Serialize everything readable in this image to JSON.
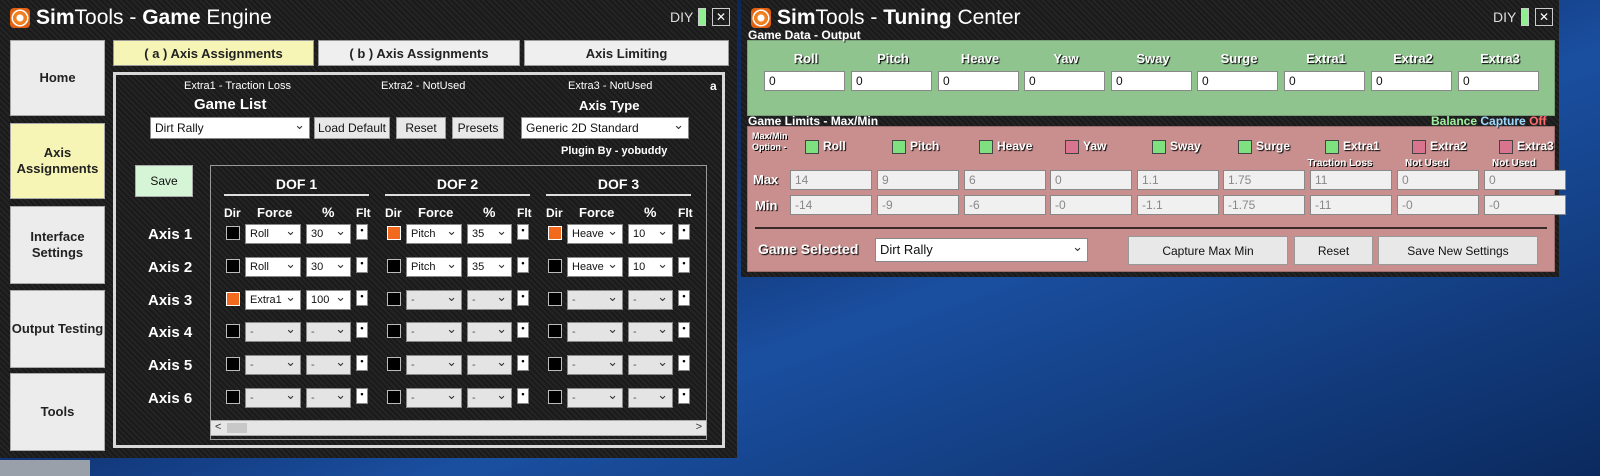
{
  "game_engine": {
    "title_light": "Sim",
    "title_rest": "Tools - ",
    "title_bold": "Game",
    "title_end": " Engine",
    "diy": "DIY",
    "close": "✕",
    "nav": [
      {
        "label": "Home"
      },
      {
        "label": "Axis Assignments"
      },
      {
        "label": "Interface Settings"
      },
      {
        "label": "Output Testing"
      },
      {
        "label": "Tools"
      }
    ],
    "tabs": [
      {
        "label": "( a ) Axis Assignments"
      },
      {
        "label": "( b ) Axis Assignments"
      },
      {
        "label": "Axis Limiting"
      }
    ],
    "extra1": "Extra1 - Traction Loss",
    "extra2": "Extra2 - NotUsed",
    "extra3": "Extra3 - NotUsed",
    "corner": "a",
    "game_list_label": "Game List",
    "axis_type_label": "Axis Type",
    "game_value": "Dirt Rally",
    "load_default": "Load Default",
    "reset": "Reset",
    "presets": "Presets",
    "axis_type_value": "Generic 2D Standard",
    "plugin": "Plugin By - yobuddy",
    "save": "Save",
    "dof": [
      "DOF 1",
      "DOF 2",
      "DOF 3"
    ],
    "col_headers": {
      "dir": "Dir",
      "force": "Force",
      "pct": "%",
      "flt": "Flt"
    },
    "flt_mark": "•",
    "axes": [
      {
        "label": "Axis 1",
        "cells": [
          {
            "dir": false,
            "force": "Roll",
            "pct": "30"
          },
          {
            "dir": true,
            "force": "Pitch",
            "pct": "35"
          },
          {
            "dir": true,
            "force": "Heave",
            "pct": "10"
          }
        ]
      },
      {
        "label": "Axis 2",
        "cells": [
          {
            "dir": false,
            "force": "Roll",
            "pct": "30"
          },
          {
            "dir": false,
            "force": "Pitch",
            "pct": "35"
          },
          {
            "dir": false,
            "force": "Heave",
            "pct": "10"
          }
        ]
      },
      {
        "label": "Axis 3",
        "cells": [
          {
            "dir": true,
            "force": "Extra1",
            "pct": "100"
          },
          {
            "dir": false,
            "force": "-",
            "pct": "-"
          },
          {
            "dir": false,
            "force": "-",
            "pct": "-"
          }
        ]
      },
      {
        "label": "Axis 4",
        "cells": [
          {
            "dir": false,
            "force": "-",
            "pct": "-"
          },
          {
            "dir": false,
            "force": "-",
            "pct": "-"
          },
          {
            "dir": false,
            "force": "-",
            "pct": "-"
          }
        ]
      },
      {
        "label": "Axis 5",
        "cells": [
          {
            "dir": false,
            "force": "-",
            "pct": "-"
          },
          {
            "dir": false,
            "force": "-",
            "pct": "-"
          },
          {
            "dir": false,
            "force": "-",
            "pct": "-"
          }
        ]
      },
      {
        "label": "Axis 6",
        "cells": [
          {
            "dir": false,
            "force": "-",
            "pct": "-"
          },
          {
            "dir": false,
            "force": "-",
            "pct": "-"
          },
          {
            "dir": false,
            "force": "-",
            "pct": "-"
          }
        ]
      }
    ],
    "scroll_left": "<",
    "scroll_right": ">"
  },
  "tuning": {
    "title_light": "Sim",
    "title_rest": "Tools - ",
    "title_bold": "Tuning",
    "title_end": " Center",
    "diy": "DIY",
    "close": "✕",
    "game_data_label": "Game Data - Output",
    "game_limits_label": "Game Limits - Max/Min",
    "balance": "Balance",
    "capture": "Capture",
    "off": "Off",
    "option_label": "Max/Min Option -",
    "max_label": "Max",
    "min_label": "Min",
    "channels": [
      {
        "name": "Roll",
        "output": "0",
        "max": "14",
        "min": "-14",
        "sub": "",
        "color": "#7ee07e"
      },
      {
        "name": "Pitch",
        "output": "0",
        "max": "9",
        "min": "-9",
        "sub": "",
        "color": "#7ee07e"
      },
      {
        "name": "Heave",
        "output": "0",
        "max": "6",
        "min": "-6",
        "sub": "",
        "color": "#7ee07e"
      },
      {
        "name": "Yaw",
        "output": "0",
        "max": "0",
        "min": "-0",
        "sub": "",
        "color": "#d9748f"
      },
      {
        "name": "Sway",
        "output": "0",
        "max": "1.1",
        "min": "-1.1",
        "sub": "",
        "color": "#7ee07e"
      },
      {
        "name": "Surge",
        "output": "0",
        "max": "1.75",
        "min": "-1.75",
        "sub": "",
        "color": "#7ee07e"
      },
      {
        "name": "Extra1",
        "output": "0",
        "max": "11",
        "min": "-11",
        "sub": "Traction Loss",
        "color": "#7ee07e"
      },
      {
        "name": "Extra2",
        "output": "0",
        "max": "0",
        "min": "-0",
        "sub": "Not Used",
        "color": "#d9748f"
      },
      {
        "name": "Extra3",
        "output": "0",
        "max": "0",
        "min": "-0",
        "sub": "Not Used",
        "color": "#d9748f"
      }
    ],
    "game_selected_label": "Game Selected",
    "game_selected_value": "Dirt Rally",
    "capture_btn": "Capture Max Min",
    "reset_btn": "Reset",
    "save_btn": "Save New Settings"
  }
}
